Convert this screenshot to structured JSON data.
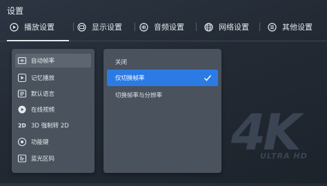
{
  "title": "设置",
  "tabs": [
    {
      "label": "播放设置",
      "icon": "play-circle-icon",
      "active": true
    },
    {
      "label": "显示设置",
      "icon": "display-icon"
    },
    {
      "label": "音频设置",
      "icon": "audio-icon"
    },
    {
      "label": "网络设置",
      "icon": "globe-icon"
    },
    {
      "label": "其他设置",
      "icon": "menu-list-icon"
    }
  ],
  "menu": [
    {
      "label": "自动帧率",
      "icon": "auto-framerate-icon",
      "active": true
    },
    {
      "label": "记忆播放",
      "icon": "memory-play-icon"
    },
    {
      "label": "默认语言",
      "icon": "language-icon"
    },
    {
      "label": "在线视频",
      "icon": "online-video-icon"
    },
    {
      "label": "3D 强制转 2D",
      "icon": "3d-2d-icon",
      "icon_text": "2D"
    },
    {
      "label": "功能键",
      "icon": "function-key-icon"
    },
    {
      "label": "蓝光区码",
      "icon": "bluray-region-icon"
    }
  ],
  "options": [
    {
      "label": "关闭"
    },
    {
      "label": "仅切换帧率",
      "selected": true
    },
    {
      "label": "切换帧率与分辨率"
    }
  ],
  "watermark": {
    "big": "4K",
    "small": "ULTRA HD"
  },
  "colors": {
    "accent": "#2c7be5",
    "panel": "#4a525d",
    "background": "#252c36"
  }
}
